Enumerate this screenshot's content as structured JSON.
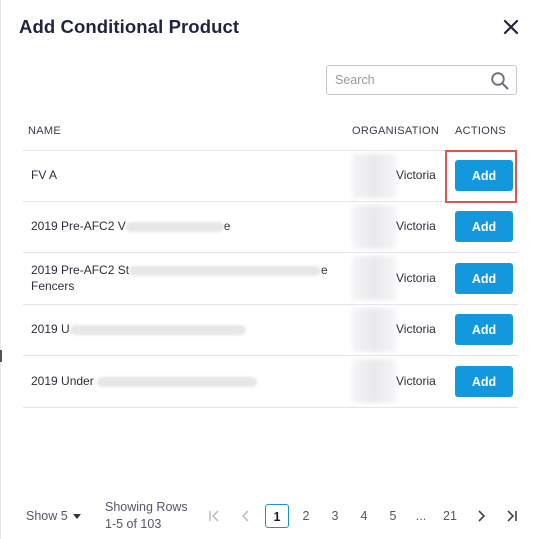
{
  "dialog": {
    "title": "Add Conditional Product"
  },
  "search": {
    "placeholder": "Search",
    "value": ""
  },
  "table": {
    "headers": [
      "NAME",
      "ORGANISATION",
      "ACTIONS"
    ],
    "rows": [
      {
        "name_line1": "FV A",
        "name_line2": "",
        "name_suffix": "",
        "organisation": "Victoria",
        "action": "Add"
      },
      {
        "name_line1": "2019 Pre-AFC2 V",
        "name_line2": "",
        "name_suffix": "e",
        "organisation": "Victoria",
        "action": "Add"
      },
      {
        "name_line1": "2019 Pre-AFC2 St",
        "name_line2": "Fencers",
        "name_suffix": "e",
        "organisation": "Victoria",
        "action": "Add"
      },
      {
        "name_line1": "2019 U",
        "name_line2": "",
        "name_suffix": "",
        "organisation": "Victoria",
        "action": "Add"
      },
      {
        "name_line1": "2019 Under",
        "name_line2": "",
        "name_suffix": "",
        "organisation": "Victoria",
        "action": "Add"
      }
    ]
  },
  "footer": {
    "show_label": "Show 5",
    "showing_rows_label": "Showing Rows",
    "showing_rows_range": "1-5 of 103",
    "pages": [
      "1",
      "2",
      "3",
      "4",
      "5",
      "...",
      "21"
    ],
    "current_page": "1"
  },
  "colors": {
    "accent": "#1397dd",
    "highlight": "#e0534f"
  }
}
